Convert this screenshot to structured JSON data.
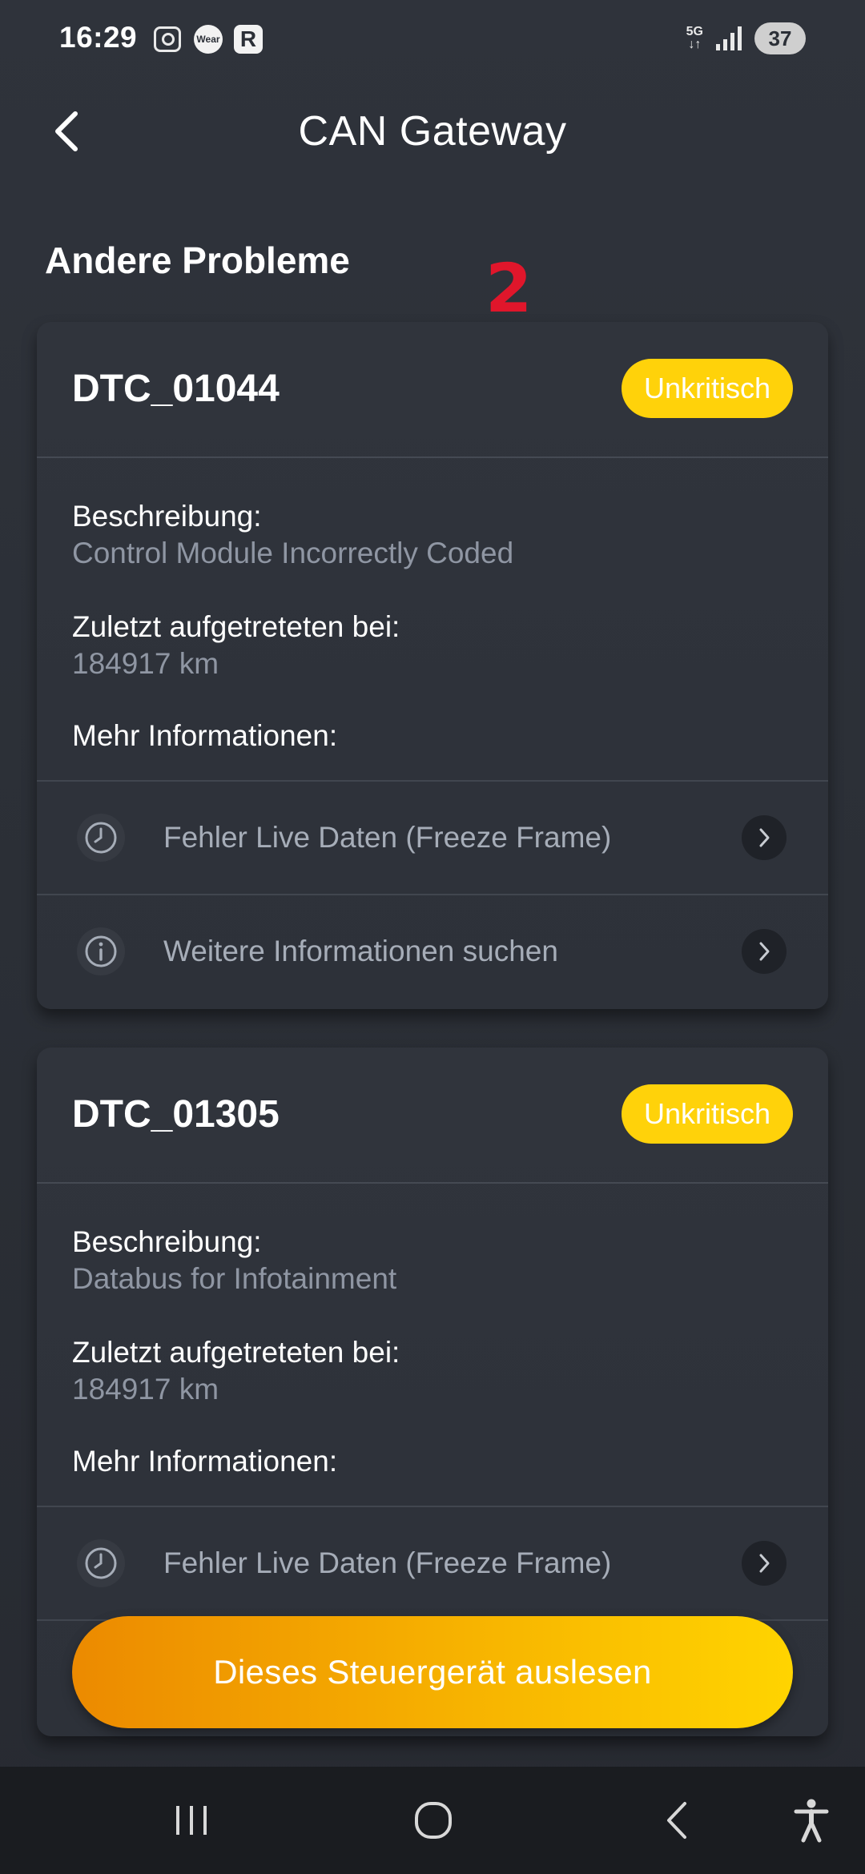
{
  "status_bar": {
    "time": "16:29",
    "wear_label": "Wear",
    "r_label": "R",
    "network": "5G",
    "battery": "37"
  },
  "header": {
    "title": "CAN Gateway"
  },
  "section": {
    "title": "Andere Probleme",
    "annotation": "2"
  },
  "cards": [
    {
      "code": "DTC_01044",
      "badge": "Unkritisch",
      "description_label": "Beschreibung:",
      "description_value": "Control Module Incorrectly Coded",
      "last_seen_label": "Zuletzt aufgetreteten bei:",
      "last_seen_value": "184917 km",
      "more_label": "Mehr Informationen:",
      "actions": [
        "Fehler Live Daten (Freeze Frame)",
        "Weitere Informationen suchen"
      ]
    },
    {
      "code": "DTC_01305",
      "badge": "Unkritisch",
      "description_label": "Beschreibung:",
      "description_value": "Databus for Infotainment",
      "last_seen_label": "Zuletzt aufgetreteten bei:",
      "last_seen_value": "184917 km",
      "more_label": "Mehr Informationen:",
      "actions": [
        "Fehler Live Daten (Freeze Frame)"
      ]
    }
  ],
  "cta": {
    "label": "Dieses Steuergerät auslesen"
  },
  "colors": {
    "accent": "#ffd20a",
    "cta_start": "#ec8a00",
    "cta_end": "#ffd400",
    "annotation": "#e0162b"
  },
  "icons": {
    "back": "chevron-left-icon",
    "clock": "clock-icon",
    "info": "info-icon",
    "chevron": "chevron-right-icon"
  }
}
